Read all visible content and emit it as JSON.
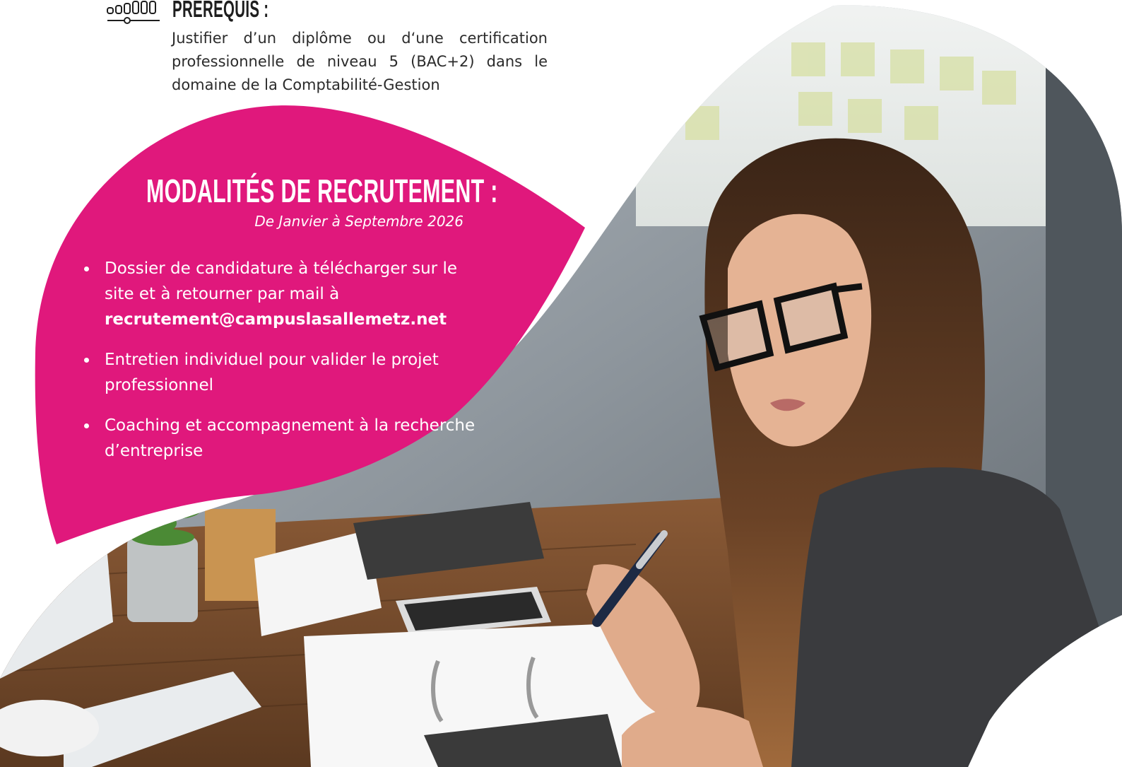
{
  "prerequis": {
    "icon": "level-slider-icon",
    "title": "PRÉREQUIS :",
    "text": "Justifier d’un diplôme ou d‘une certification professionnelle de niveau 5 (BAC+2) dans le domaine de la Comptabilité-Gestion"
  },
  "recrutement": {
    "title": "MODALITÉS DE RECRUTEMENT :",
    "subtitle": "De Janvier à Septembre 2026",
    "items": [
      {
        "text": "Dossier de candidature à télécharger sur le site et à retourner par mail à",
        "email": "recrutement@campuslasallemetz.net"
      },
      {
        "text": "Entretien individuel pour valider le projet professionnel"
      },
      {
        "text": "Coaching et accompagnement à la recherche d’entreprise"
      }
    ]
  },
  "colors": {
    "accent_pink": "#E0187C",
    "text_dark": "#2b2b2b",
    "white": "#ffffff"
  }
}
